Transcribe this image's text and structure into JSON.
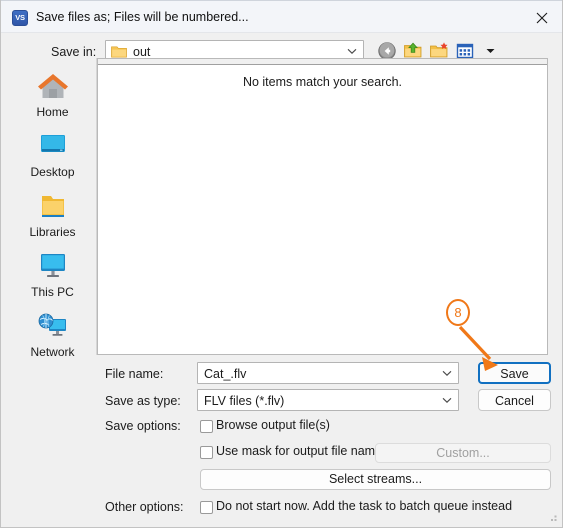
{
  "window": {
    "title": "Save files as; Files will be numbered...",
    "app_icon": "vs-app-icon",
    "app_icon_text": "VS",
    "close_label": "close-icon"
  },
  "toolbar": {
    "save_in_label": "Save in:",
    "current_folder": "out",
    "back_button": "back-icon",
    "up_button": "up-one-level-icon",
    "new_folder_button": "create-new-folder-icon",
    "views_button": "views-icon"
  },
  "places": {
    "items": [
      {
        "label": "Home",
        "icon": "home-icon"
      },
      {
        "label": "Desktop",
        "icon": "desktop-icon"
      },
      {
        "label": "Libraries",
        "icon": "libraries-folder-icon"
      },
      {
        "label": "This PC",
        "icon": "this-pc-icon"
      },
      {
        "label": "Network",
        "icon": "network-icon"
      }
    ]
  },
  "filelist": {
    "empty_message": "No items match your search."
  },
  "form": {
    "file_name_label": "File name:",
    "file_name_value": "Cat_.flv",
    "save_as_type_label": "Save as type:",
    "save_as_type_value": "FLV files (*.flv)",
    "save_button": "Save",
    "cancel_button": "Cancel"
  },
  "save_options": {
    "label": "Save options:",
    "browse_output": "Browse output file(s)",
    "browse_output_checked": false,
    "use_mask": "Use mask for output file names",
    "use_mask_checked": false,
    "custom_button": "Custom...",
    "custom_button_enabled": false,
    "select_streams_button": "Select streams..."
  },
  "other_options": {
    "label": "Other options:",
    "batch_queue": "Do not start now. Add the task to batch queue instead",
    "batch_queue_checked": false
  },
  "annotation": {
    "step_number": "8",
    "points_to": "save-button",
    "color": "#f07818"
  },
  "colors": {
    "accent": "#1170c1",
    "titlebar": "#f3f5f9",
    "dialog_bg": "#f0f0f0",
    "annotation": "#f07818"
  }
}
